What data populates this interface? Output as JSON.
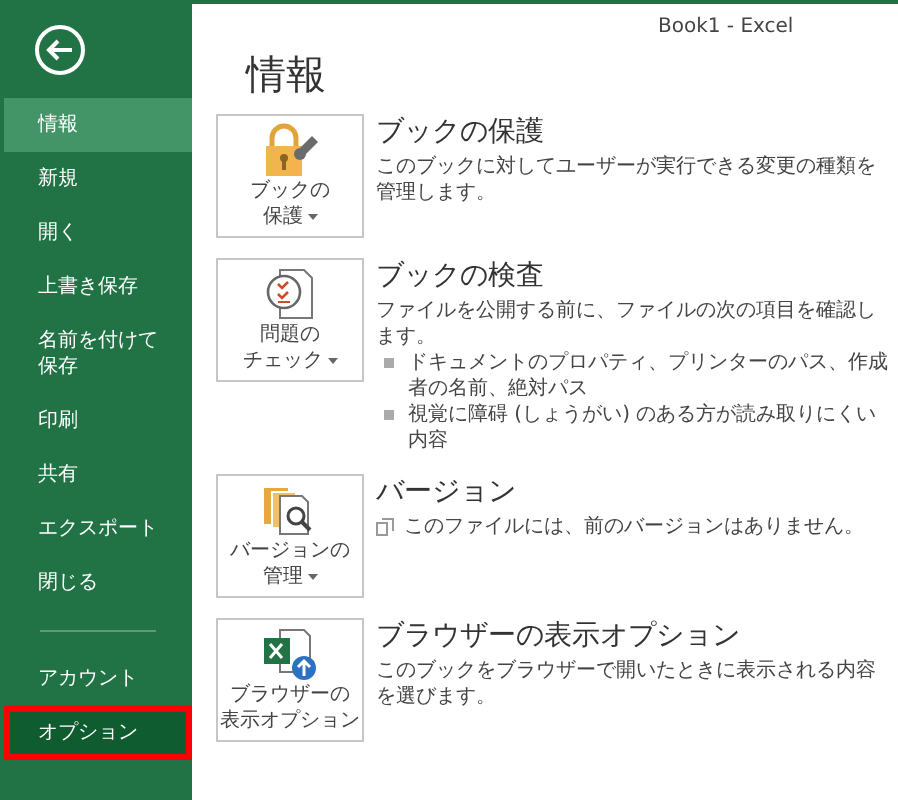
{
  "window": {
    "title": "Book1 - Excel"
  },
  "sidebar": {
    "items": [
      {
        "label": "情報",
        "selected": true,
        "highlighted": false
      },
      {
        "label": "新規",
        "selected": false,
        "highlighted": false
      },
      {
        "label": "開く",
        "selected": false,
        "highlighted": false
      },
      {
        "label": "上書き保存",
        "selected": false,
        "highlighted": false
      },
      {
        "label": "名前を付けて保存",
        "selected": false,
        "highlighted": false
      },
      {
        "label": "印刷",
        "selected": false,
        "highlighted": false
      },
      {
        "label": "共有",
        "selected": false,
        "highlighted": false
      },
      {
        "label": "エクスポート",
        "selected": false,
        "highlighted": false
      },
      {
        "label": "閉じる",
        "selected": false,
        "highlighted": false
      },
      {
        "kind": "separator"
      },
      {
        "label": "アカウント",
        "selected": false,
        "highlighted": false
      },
      {
        "label": "オプション",
        "selected": false,
        "highlighted": true
      }
    ]
  },
  "page_title": "情報",
  "sections": [
    {
      "kind": "lock",
      "button_lines": [
        "ブックの",
        "保護"
      ],
      "dropdown": true,
      "title": "ブックの保護",
      "lines": [
        {
          "kind": "text",
          "text": "このブックに対してユーザーが実行できる変更の種類を管理します。"
        }
      ]
    },
    {
      "kind": "inspect",
      "button_lines": [
        "問題の",
        "チェック"
      ],
      "dropdown": true,
      "title": "ブックの検査",
      "lines": [
        {
          "kind": "text",
          "text": "ファイルを公開する前に、ファイルの次の項目を確認します。"
        },
        {
          "kind": "bullet",
          "text": "ドキュメントのプロパティ、プリンターのパス、作成者の名前、絶対パス"
        },
        {
          "kind": "bullet",
          "text": "視覚に障碍 (しょうがい) のある方が読み取りにくい内容"
        }
      ]
    },
    {
      "kind": "versions",
      "button_lines": [
        "バージョンの",
        "管理"
      ],
      "dropdown": true,
      "title": "バージョン",
      "lines": [
        {
          "kind": "note",
          "text": "このファイルには、前のバージョンはありません。"
        }
      ]
    },
    {
      "kind": "browser",
      "button_lines": [
        "ブラウザーの",
        "表示オプション"
      ],
      "dropdown": false,
      "title": "ブラウザーの表示オプション",
      "lines": [
        {
          "kind": "text",
          "text": "このブックをブラウザーで開いたときに表示される内容を選びます。"
        }
      ]
    }
  ]
}
